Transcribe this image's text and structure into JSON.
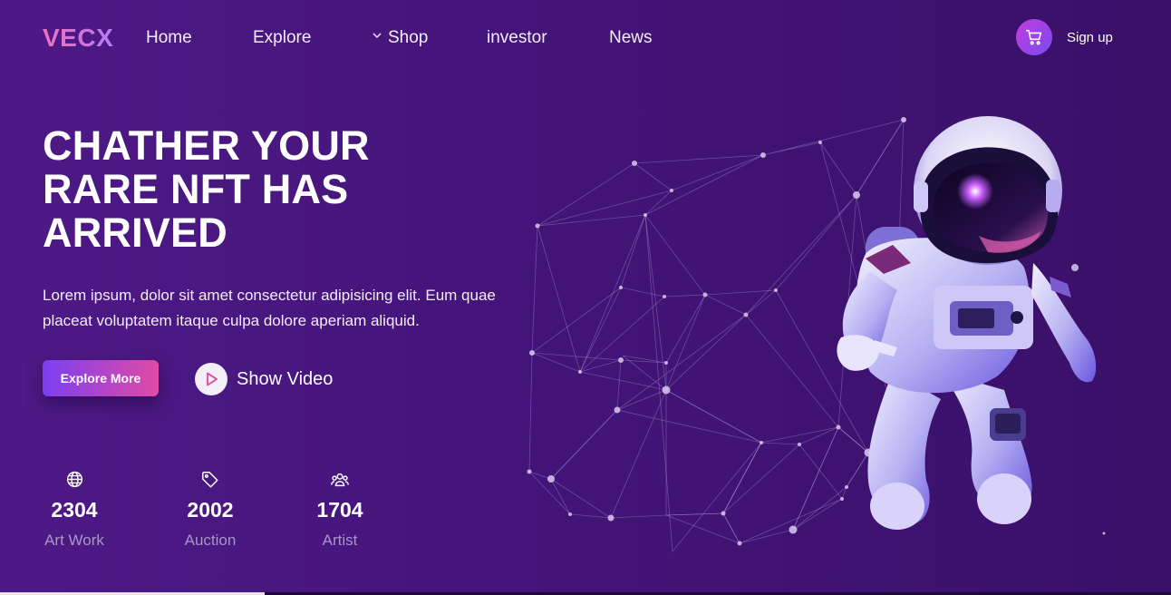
{
  "nav": {
    "logo": "VECX",
    "links": [
      "Home",
      "Explore",
      "Shop",
      "investor",
      "News"
    ],
    "signup": "Sign up",
    "cart_icon": "cart-icon"
  },
  "hero": {
    "title_lines": [
      "CHATHER YOUR",
      "RARE NFT HAS",
      "ARRIVED"
    ],
    "description": "Lorem ipsum, dolor sit amet consectetur adipisicing elit. Eum quae placeat voluptatem itaque culpa dolore aperiam aliquid.",
    "explore_button": "Explore More",
    "video_button": "Show Video"
  },
  "stats": [
    {
      "icon": "globe-icon",
      "value": "2304",
      "label": "Art Work"
    },
    {
      "icon": "tag-icon",
      "value": "2002",
      "label": "Auction"
    },
    {
      "icon": "users-icon",
      "value": "1704",
      "label": "Artist"
    }
  ],
  "colors": {
    "background": "#451580",
    "accent_gradient_start": "#7a3ff0",
    "accent_gradient_end": "#e14aa6",
    "logo_pink": "#f06ec0"
  }
}
